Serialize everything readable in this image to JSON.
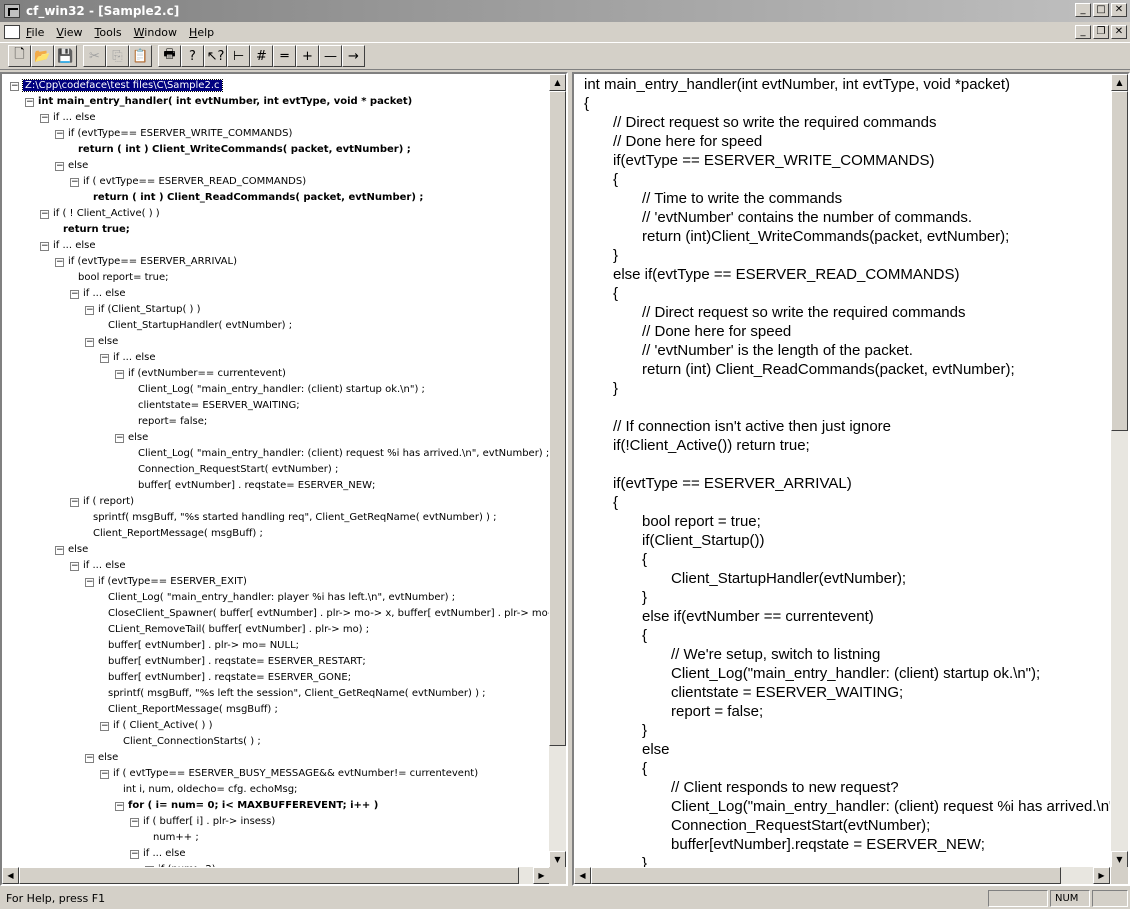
{
  "window": {
    "title": "cf_win32 - [Sample2.c]"
  },
  "menu": [
    "File",
    "View",
    "Tools",
    "Window",
    "Help"
  ],
  "toolbar": {
    "buttons": [
      {
        "name": "new-file",
        "glyph": "🗋"
      },
      {
        "name": "open-folder",
        "glyph": "📂"
      },
      {
        "name": "save",
        "glyph": "💾"
      },
      {
        "name": "cut",
        "glyph": "✂"
      },
      {
        "name": "copy",
        "glyph": "⎘"
      },
      {
        "name": "paste",
        "glyph": "📋"
      },
      {
        "name": "print",
        "glyph": "🖶"
      },
      {
        "name": "help",
        "glyph": "?"
      },
      {
        "name": "context-help",
        "glyph": "↖?"
      },
      {
        "name": "tree-view",
        "glyph": "⊢"
      },
      {
        "name": "hash",
        "glyph": "#"
      },
      {
        "name": "collapse",
        "glyph": "═"
      },
      {
        "name": "plus",
        "glyph": "+"
      },
      {
        "name": "minus",
        "glyph": "—"
      },
      {
        "name": "go-arrow",
        "glyph": "→"
      }
    ]
  },
  "tree": {
    "rows": [
      {
        "indent": 0,
        "toggle": "-",
        "text": "Z:\\Cpp\\codeface\\test files\\C\\Sample2.c",
        "selected": true
      },
      {
        "indent": 1,
        "toggle": "-",
        "text": "int main_entry_handler( int evtNumber, int evtType, void * packet)",
        "bold": true
      },
      {
        "indent": 2,
        "toggle": "-",
        "text": "if ... else"
      },
      {
        "indent": 3,
        "toggle": "-",
        "text": "if (evtType== ESERVER_WRITE_COMMANDS)"
      },
      {
        "indent": 4,
        "toggle": "",
        "text": "return ( int ) Client_WriteCommands( packet, evtNumber) ;",
        "bold": true
      },
      {
        "indent": 3,
        "toggle": "-",
        "text": "else"
      },
      {
        "indent": 4,
        "toggle": "-",
        "text": "if ( evtType== ESERVER_READ_COMMANDS)"
      },
      {
        "indent": 5,
        "toggle": "",
        "text": "return ( int ) Client_ReadCommands( packet, evtNumber) ;",
        "bold": true
      },
      {
        "indent": 2,
        "toggle": "-",
        "text": "if ( ! Client_Active( ) )"
      },
      {
        "indent": 3,
        "toggle": "",
        "text": "return true;",
        "bold": true
      },
      {
        "indent": 2,
        "toggle": "-",
        "text": "if ... else"
      },
      {
        "indent": 3,
        "toggle": "-",
        "text": "if (evtType== ESERVER_ARRIVAL)"
      },
      {
        "indent": 4,
        "toggle": "",
        "text": "bool report= true;"
      },
      {
        "indent": 4,
        "toggle": "-",
        "text": "if ... else"
      },
      {
        "indent": 5,
        "toggle": "-",
        "text": "if (Client_Startup( ) )"
      },
      {
        "indent": 6,
        "toggle": "",
        "text": "Client_StartupHandler( evtNumber) ;"
      },
      {
        "indent": 5,
        "toggle": "-",
        "text": "else"
      },
      {
        "indent": 6,
        "toggle": "-",
        "text": "if ... else"
      },
      {
        "indent": 7,
        "toggle": "-",
        "text": "if (evtNumber== currentevent)"
      },
      {
        "indent": 8,
        "toggle": "",
        "text": "Client_Log( \"main_entry_handler: (client) startup ok.\\n\") ;"
      },
      {
        "indent": 8,
        "toggle": "",
        "text": "clientstate= ESERVER_WAITING;"
      },
      {
        "indent": 8,
        "toggle": "",
        "text": "report= false;"
      },
      {
        "indent": 7,
        "toggle": "-",
        "text": "else"
      },
      {
        "indent": 8,
        "toggle": "",
        "text": "Client_Log( \"main_entry_handler: (client) request %i has arrived.\\n\", evtNumber) ;"
      },
      {
        "indent": 8,
        "toggle": "",
        "text": "Connection_RequestStart( evtNumber) ;"
      },
      {
        "indent": 8,
        "toggle": "",
        "text": "buffer[ evtNumber] . reqstate= ESERVER_NEW;"
      },
      {
        "indent": 4,
        "toggle": "-",
        "text": "if ( report)"
      },
      {
        "indent": 5,
        "toggle": "",
        "text": "sprintf( msgBuff, \"%s started handling req\", Client_GetReqName( evtNumber) ) ;"
      },
      {
        "indent": 5,
        "toggle": "",
        "text": "Client_ReportMessage( msgBuff) ;"
      },
      {
        "indent": 3,
        "toggle": "-",
        "text": "else"
      },
      {
        "indent": 4,
        "toggle": "-",
        "text": "if ... else"
      },
      {
        "indent": 5,
        "toggle": "-",
        "text": "if (evtType== ESERVER_EXIT)"
      },
      {
        "indent": 6,
        "toggle": "",
        "text": "Client_Log( \"main_entry_handler: player %i has left.\\n\", evtNumber) ;"
      },
      {
        "indent": 6,
        "toggle": "",
        "text": "CloseClient_Spawner( buffer[ evtNumber] . plr-> mo-> x, buffer[ evtNumber] . plr-> mo->"
      },
      {
        "indent": 6,
        "toggle": "",
        "text": "CLient_RemoveTail( buffer[ evtNumber] . plr-> mo) ;"
      },
      {
        "indent": 6,
        "toggle": "",
        "text": "buffer[ evtNumber] . plr-> mo= NULL;"
      },
      {
        "indent": 6,
        "toggle": "",
        "text": "buffer[ evtNumber] . reqstate= ESERVER_RESTART;"
      },
      {
        "indent": 6,
        "toggle": "",
        "text": "buffer[ evtNumber] . reqstate= ESERVER_GONE;"
      },
      {
        "indent": 6,
        "toggle": "",
        "text": "sprintf( msgBuff, \"%s left the session\", Client_GetReqName( evtNumber) ) ;"
      },
      {
        "indent": 6,
        "toggle": "",
        "text": "Client_ReportMessage( msgBuff) ;"
      },
      {
        "indent": 6,
        "toggle": "-",
        "text": "if ( Client_Active( ) )"
      },
      {
        "indent": 7,
        "toggle": "",
        "text": "Client_ConnectionStarts( ) ;"
      },
      {
        "indent": 5,
        "toggle": "-",
        "text": "else"
      },
      {
        "indent": 6,
        "toggle": "-",
        "text": "if ( evtType== ESERVER_BUSY_MESSAGE&& evtNumber!= currentevent)"
      },
      {
        "indent": 7,
        "toggle": "",
        "text": "int i, num, oldecho= cfg. echoMsg;"
      },
      {
        "indent": 7,
        "toggle": "-",
        "text": "for ( i= num= 0; i< MAXBUFFEREVENT; i++ )",
        "bold": true
      },
      {
        "indent": 8,
        "toggle": "-",
        "text": "if ( buffer[ i] . plr-> insess)"
      },
      {
        "indent": 9,
        "toggle": "",
        "text": "num++ ;"
      },
      {
        "indent": 8,
        "toggle": "-",
        "text": "if ... else"
      },
      {
        "indent": 9,
        "toggle": "-",
        "text": "if (num> 2)"
      }
    ]
  },
  "code": {
    "lines": [
      {
        "indent": 0,
        "text": "int main_entry_handler(int evtNumber, int evtType, void *packet)"
      },
      {
        "indent": 0,
        "text": "{"
      },
      {
        "indent": 1,
        "text": "// Direct request so write the required commands"
      },
      {
        "indent": 1,
        "text": "// Done here for speed"
      },
      {
        "indent": 1,
        "text": "if(evtType == ESERVER_WRITE_COMMANDS)"
      },
      {
        "indent": 1,
        "text": "{"
      },
      {
        "indent": 2,
        "text": "// Time to write the commands"
      },
      {
        "indent": 2,
        "text": "// 'evtNumber' contains the number of commands."
      },
      {
        "indent": 2,
        "text": "return (int)Client_WriteCommands(packet, evtNumber);"
      },
      {
        "indent": 1,
        "text": "}"
      },
      {
        "indent": 1,
        "text": "else if(evtType == ESERVER_READ_COMMANDS)"
      },
      {
        "indent": 1,
        "text": "{"
      },
      {
        "indent": 2,
        "text": "// Direct request so write the required commands"
      },
      {
        "indent": 2,
        "text": "// Done here for speed"
      },
      {
        "indent": 2,
        "text": "// 'evtNumber' is the length of the packet."
      },
      {
        "indent": 2,
        "text": "return (int) Client_ReadCommands(packet, evtNumber);"
      },
      {
        "indent": 1,
        "text": "}"
      },
      {
        "indent": 0,
        "text": ""
      },
      {
        "indent": 1,
        "text": "// If connection isn't active then just ignore"
      },
      {
        "indent": 1,
        "text": "if(!Client_Active()) return true;"
      },
      {
        "indent": 0,
        "text": ""
      },
      {
        "indent": 1,
        "text": "if(evtType == ESERVER_ARRIVAL)"
      },
      {
        "indent": 1,
        "text": "{"
      },
      {
        "indent": 2,
        "text": "bool report = true;"
      },
      {
        "indent": 2,
        "text": "if(Client_Startup())"
      },
      {
        "indent": 2,
        "text": "{"
      },
      {
        "indent": 3,
        "text": "Client_StartupHandler(evtNumber);"
      },
      {
        "indent": 2,
        "text": "}"
      },
      {
        "indent": 2,
        "text": "else if(evtNumber == currentevent)"
      },
      {
        "indent": 2,
        "text": "{"
      },
      {
        "indent": 3,
        "text": "// We're setup, switch to listning"
      },
      {
        "indent": 3,
        "text": "Client_Log(\"main_entry_handler: (client) startup ok.\\n\");"
      },
      {
        "indent": 3,
        "text": "clientstate = ESERVER_WAITING;"
      },
      {
        "indent": 3,
        "text": "report = false;"
      },
      {
        "indent": 2,
        "text": "}"
      },
      {
        "indent": 2,
        "text": "else"
      },
      {
        "indent": 2,
        "text": "{"
      },
      {
        "indent": 3,
        "text": "// Client responds to new request?"
      },
      {
        "indent": 3,
        "text": "Client_Log(\"main_entry_handler: (client) request %i has arrived.\\n\", evtNumber);"
      },
      {
        "indent": 3,
        "text": "Connection_RequestStart(evtNumber);"
      },
      {
        "indent": 3,
        "text": "buffer[evtNumber].reqstate = ESERVER_NEW;"
      },
      {
        "indent": 2,
        "text": "}"
      }
    ]
  },
  "status": {
    "text": "For Help, press F1",
    "num": "NUM"
  }
}
